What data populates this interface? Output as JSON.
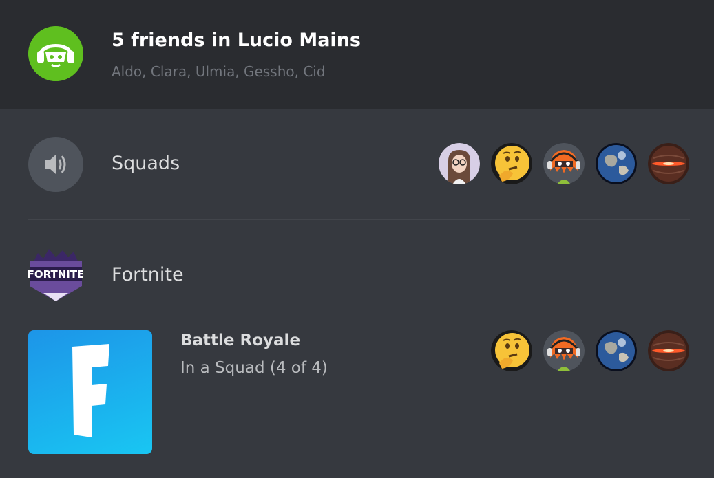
{
  "header": {
    "title": "5 friends in Lucio Mains",
    "members": "Aldo, Clara, Ulmia, Gessho, Cid",
    "guild_icon": "lucio-mains-guild-icon"
  },
  "voice_channel": {
    "icon": "speaker-icon",
    "name": "Squads",
    "participants": [
      {
        "avatar": "woman-with-glasses-avatar"
      },
      {
        "avatar": "thinking-face-avatar"
      },
      {
        "avatar": "inkling-girl-avatar"
      },
      {
        "avatar": "earth-globe-avatar"
      },
      {
        "avatar": "red-glow-sphere-avatar"
      }
    ]
  },
  "game": {
    "logo": "fortnite-logo",
    "logo_text": "FORTNITE",
    "name": "Fortnite"
  },
  "activity": {
    "art": "fortnite-f-icon",
    "art_text": "F",
    "title": "Battle Royale",
    "state": "In a Squad (4 of 4)",
    "players": [
      {
        "avatar": "thinking-face-avatar"
      },
      {
        "avatar": "inkling-girl-avatar"
      },
      {
        "avatar": "earth-globe-avatar"
      },
      {
        "avatar": "red-glow-sphere-avatar"
      }
    ]
  },
  "colors": {
    "background": "#36393f",
    "header_background": "#2a2c30",
    "guild_green": "#5fbf1f",
    "fortnite_blue": "#1d95e8"
  }
}
